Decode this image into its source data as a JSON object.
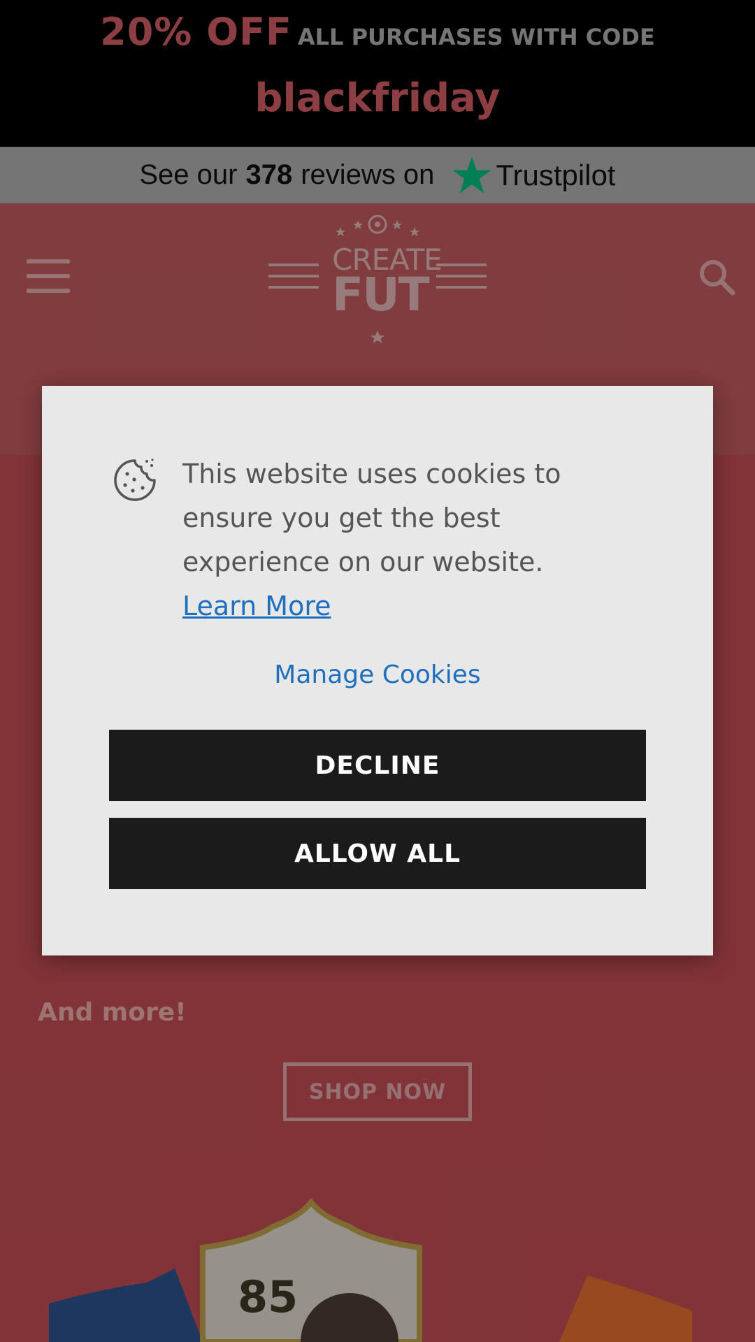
{
  "promo": {
    "discount": "20% OFF",
    "message": "ALL PURCHASES WITH CODE",
    "code": "blackfriday"
  },
  "trustpilot": {
    "prefix": "See our",
    "count": "378",
    "suffix": "reviews on",
    "brand": "Trustpilot",
    "star_color": "#00b67a"
  },
  "header": {
    "logo_line1": "CREATE",
    "logo_line2": "FUT",
    "menu_icon": "hamburger-icon",
    "search_icon": "search-icon"
  },
  "background": {
    "and_more": "And more!",
    "shop_now": "SHOP NOW",
    "card_rating": "85"
  },
  "cookie_modal": {
    "icon": "cookie-icon",
    "message": "This website uses cookies to ensure you get the best experience on our website.",
    "learn_more": "Learn More",
    "manage": "Manage Cookies",
    "decline": "DECLINE",
    "allow_all": "ALLOW ALL",
    "link_color": "#1e70bf"
  }
}
